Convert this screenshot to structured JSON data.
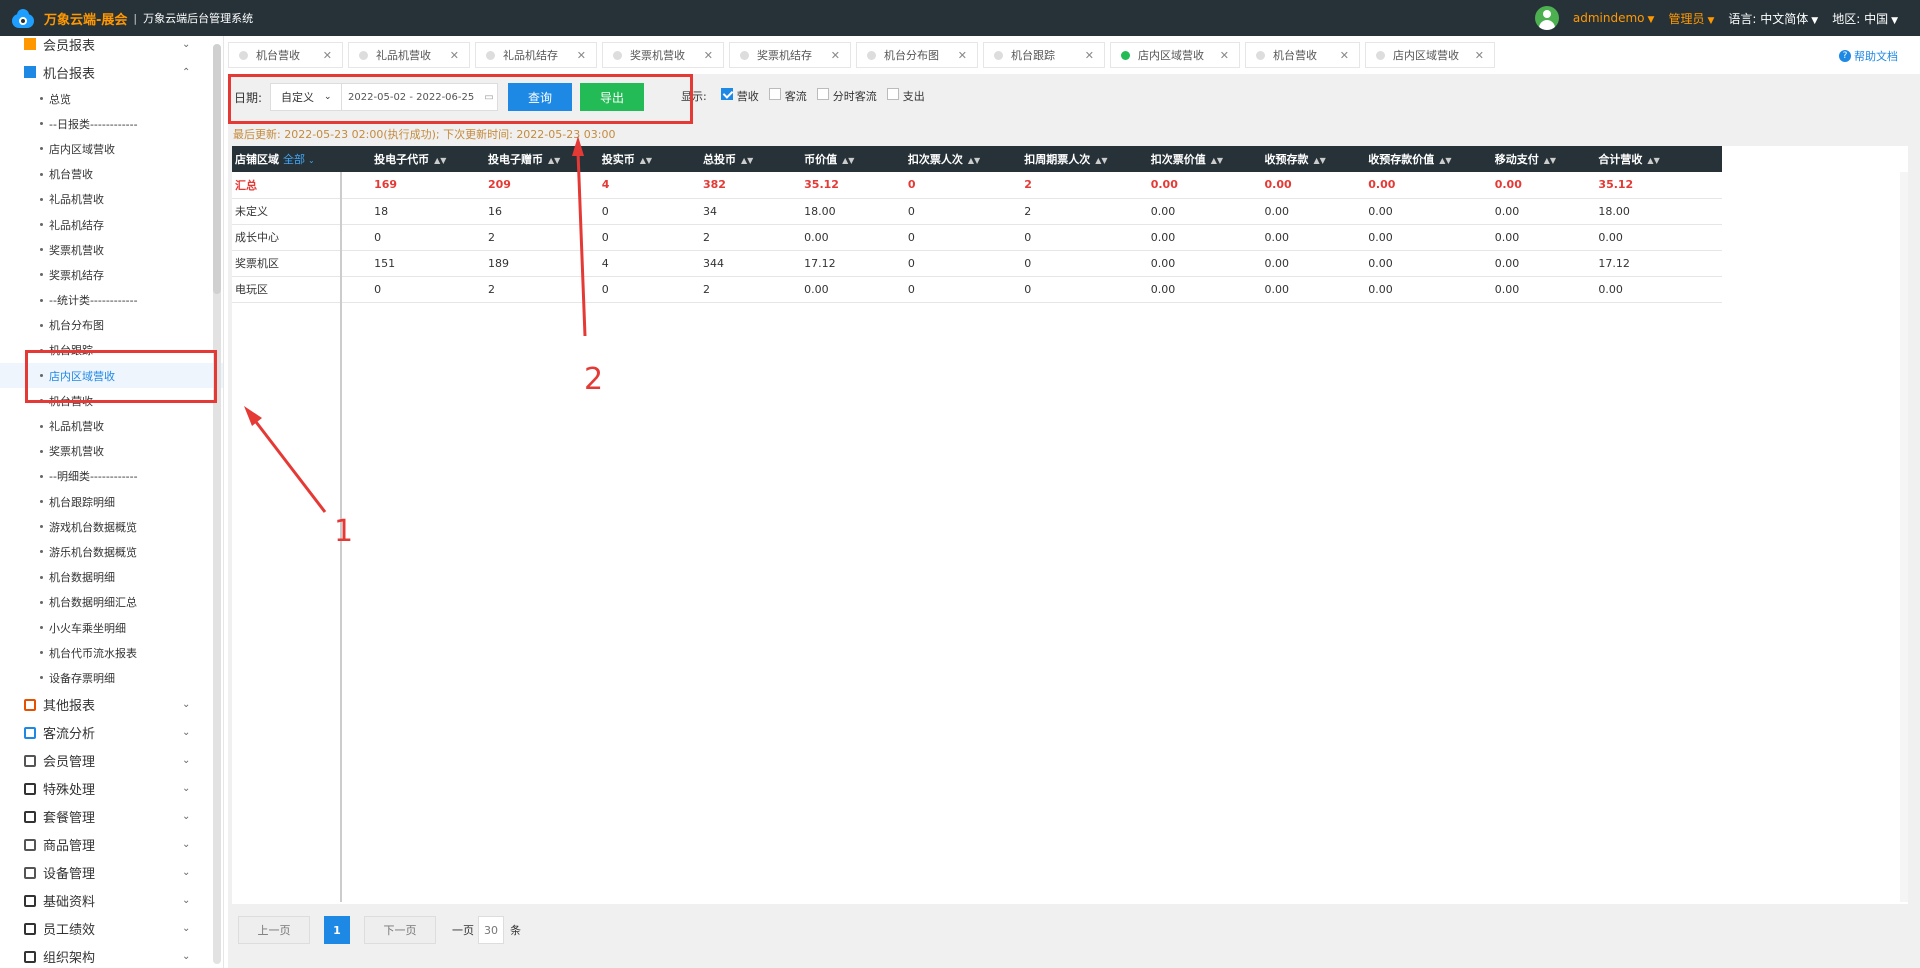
{
  "topbar": {
    "app_name": "万象云端-展会",
    "system_name": "万象云端后台管理系统",
    "user": "admindemo",
    "role": "管理员",
    "lang_label": "语言:",
    "lang_value": "中文简体",
    "region_label": "地区:",
    "region_value": "中国"
  },
  "sidebar": {
    "top_item": "会员报表",
    "group": "机台报表",
    "sub_items": [
      "总览",
      "--日报类------------",
      "店内区域营收",
      "机台营收",
      "礼品机营收",
      "礼品机结存",
      "奖票机营收",
      "奖票机结存",
      "--统计类------------",
      "机台分布图",
      "机台跟踪",
      "店内区域营收",
      "机台营收",
      "礼品机营收",
      "奖票机营收",
      "--明细类------------",
      "机台跟踪明细",
      "游戏机台数据概览",
      "游乐机台数据概览",
      "机台数据明细",
      "机台数据明细汇总",
      "小火车乘坐明细",
      "机台代币流水报表",
      "设备存票明细"
    ],
    "active_index": 11,
    "menu": [
      {
        "label": "其他报表",
        "icon": "layers-icon"
      },
      {
        "label": "客流分析",
        "icon": "target-icon"
      },
      {
        "label": "会员管理",
        "icon": "user-icon"
      },
      {
        "label": "特殊处理",
        "icon": "warning-icon"
      },
      {
        "label": "套餐管理",
        "icon": "package-icon"
      },
      {
        "label": "商品管理",
        "icon": "exchange-icon"
      },
      {
        "label": "设备管理",
        "icon": "device-icon"
      },
      {
        "label": "基础资料",
        "icon": "file-icon"
      },
      {
        "label": "员工绩效",
        "icon": "gear-icon"
      },
      {
        "label": "组织架构",
        "icon": "org-icon"
      }
    ]
  },
  "tabs": [
    "机台营收",
    "礼品机营收",
    "礼品机结存",
    "奖票机营收",
    "奖票机结存",
    "机台分布图",
    "机台跟踪",
    "店内区域营收",
    "机台营收",
    "店内区域营收"
  ],
  "active_tab": 7,
  "help": "帮助文档",
  "filter": {
    "date_label": "日期:",
    "range_type": "自定义",
    "date_range": "2022-05-02 - 2022-06-25",
    "query_button": "查询",
    "export_button": "导出",
    "display_label": "显示:",
    "options": [
      {
        "label": "营收",
        "checked": true
      },
      {
        "label": "客流",
        "checked": false
      },
      {
        "label": "分时客流",
        "checked": false
      },
      {
        "label": "支出",
        "checked": false
      }
    ]
  },
  "update_info": "最后更新: 2022-05-23 02:00(执行成功); 下次更新时间: 2022-05-23 03:00",
  "table": {
    "first_col_header": "店铺区域",
    "first_col_filter": "全部",
    "columns": [
      "投电子代币",
      "投电子赠币",
      "投实币",
      "总投币",
      "币价值",
      "扣次票人次",
      "扣周期票人次",
      "扣次票价值",
      "收预存款",
      "收预存款价值",
      "移动支付",
      "合计营收"
    ],
    "rows": [
      {
        "name": "汇总",
        "cells": [
          "169",
          "209",
          "4",
          "382",
          "35.12",
          "0",
          "2",
          "0.00",
          "0.00",
          "0.00",
          "0.00",
          "35.12"
        ]
      },
      {
        "name": "未定义",
        "cells": [
          "18",
          "16",
          "0",
          "34",
          "18.00",
          "0",
          "2",
          "0.00",
          "0.00",
          "0.00",
          "0.00",
          "18.00"
        ]
      },
      {
        "name": "成长中心",
        "cells": [
          "0",
          "2",
          "0",
          "2",
          "0.00",
          "0",
          "0",
          "0.00",
          "0.00",
          "0.00",
          "0.00",
          "0.00"
        ]
      },
      {
        "name": "奖票机区",
        "cells": [
          "151",
          "189",
          "4",
          "344",
          "17.12",
          "0",
          "0",
          "0.00",
          "0.00",
          "0.00",
          "0.00",
          "17.12"
        ]
      },
      {
        "name": "电玩区",
        "cells": [
          "0",
          "2",
          "0",
          "2",
          "0.00",
          "0",
          "0",
          "0.00",
          "0.00",
          "0.00",
          "0.00",
          "0.00"
        ]
      }
    ]
  },
  "pager": {
    "prev": "上一页",
    "current": "1",
    "next": "下一页",
    "per_page_label": "一页",
    "per_page": "30",
    "unit": "条"
  },
  "annotations": {
    "label1": "1",
    "label2": "2",
    "color": "#e53935"
  }
}
